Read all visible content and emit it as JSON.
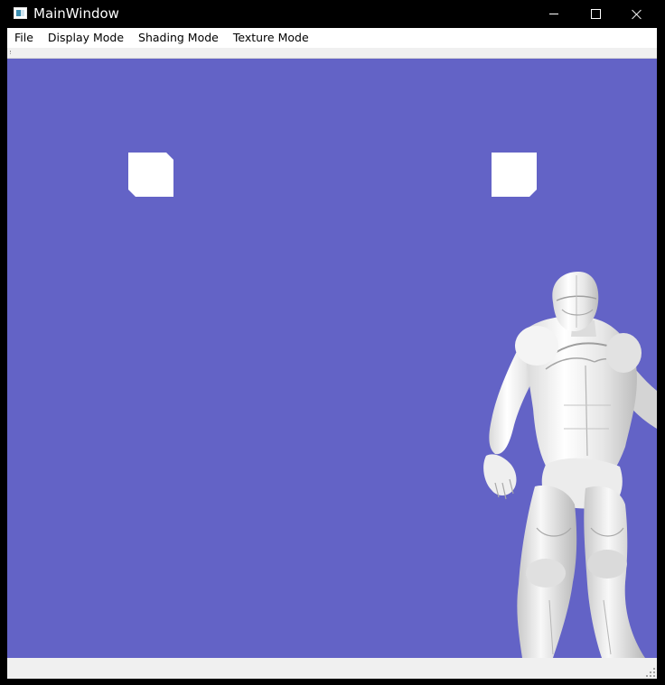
{
  "window": {
    "title": "MainWindow",
    "icon": "app-window-icon",
    "controls": {
      "minimize": "minimize-icon",
      "maximize": "maximize-icon",
      "close": "close-icon"
    }
  },
  "menubar": {
    "items": [
      {
        "label": "File"
      },
      {
        "label": "Display Mode"
      },
      {
        "label": "Shading Mode"
      },
      {
        "label": "Texture Mode"
      }
    ]
  },
  "viewport": {
    "background_color": "#6363c6",
    "model_color": "#f2f2f2",
    "scene_objects": [
      "light-marker-left",
      "light-marker-right",
      "armored-humanoid-model"
    ]
  },
  "colors": {
    "titlebar": "#000000",
    "menubar": "#ffffff",
    "statusbar": "#f0f0f0"
  }
}
